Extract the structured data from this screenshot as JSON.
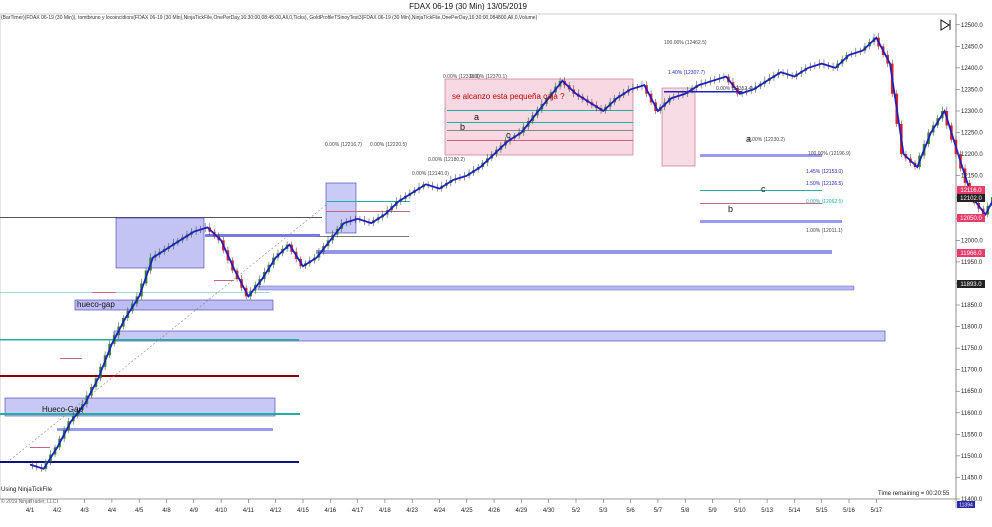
{
  "window": {
    "title": "FDAX 06-19 (30 Min)  13/05/2019",
    "indicator_line": "(BarTimer)(FDAX 06-19 (30 Min)), tomtbruno y locoincidiors(FDAX 06-19 (30 Min),NinjaTickFile,OnePerDay,16:30:00,08:45:00,All,0,Ticks), GoldProfileTSinoyTest3(FDAX 06-19 (30 Min),NinjaTickFile,OnePerDay,16:30:00,084800,All,0,Volume)",
    "time_remaining": "Time remaining = 00:20:55",
    "footer_source": "Using NinjaTickFile",
    "footer_copyright": "© 2019 NinjaTrader, LLC",
    "collapse_icon": "panel-collapse-icon"
  },
  "annotations": {
    "hueco_gap_1": "hueco-gap",
    "hueco_gap_2": "Hueco-Gap",
    "red_text": "se alcanzo esta pequeña caja ?",
    "label_a1": "a",
    "label_b1": "b",
    "label_c1": "c",
    "label_a2": "a",
    "label_b2": "b",
    "label_c2": "c"
  },
  "fib_labels": [
    "100.00% (12462.5)",
    "0.00% (12370.1)",
    "0.00% (12338.0)",
    "1.40% (12307.7)",
    "0.00% (12352.4)",
    "0.00% (12216.7)",
    "0.00% (12220.5)",
    "0.00% (12230.2)",
    "100.00% (12196.9)",
    "0.00% (12180.2)",
    "0.00% (12140.0)",
    "1.45% (12153.0)",
    "1.50% (12126.5)",
    "0.00% (12062.5)",
    "1.00% (12011.1)"
  ],
  "price_markers": [
    {
      "value": "12116.0",
      "bg": "#e83b6a"
    },
    {
      "value": "12102.0",
      "bg": "#222222"
    },
    {
      "value": "12050.0",
      "bg": "#e83b6a"
    },
    {
      "value": "11966.0",
      "bg": "#e83b6a"
    },
    {
      "value": "11893.0",
      "bg": "#222222"
    },
    {
      "value": "11394",
      "bg": "#2a2aa8"
    }
  ],
  "colors": {
    "candle_up": "#2c8a2c",
    "candle_down": "#e02020",
    "zigzag": "#2020c0",
    "box_blue": "#7a7ae6",
    "box_pink": "#f0b8cc",
    "dark_red_line": "#8b0000",
    "teal_line": "#20b0a0",
    "navy_line": "#101080",
    "text_red": "#c00000"
  },
  "chart_data": {
    "type": "candlestick",
    "title": "FDAX 06-19 (30 Min)  13/05/2019",
    "xlabel": "",
    "ylabel": "",
    "ylim": [
      11400,
      12525
    ],
    "y_ticks": [
      11400,
      11450,
      11500,
      11550,
      11600,
      11650,
      11700,
      11750,
      11800,
      11850,
      11900,
      11950,
      12000,
      12050,
      12100,
      12150,
      12200,
      12250,
      12300,
      12350,
      12400,
      12450,
      12500
    ],
    "y_tick_labels": [
      "11400.0",
      "11450.0",
      "11500.0",
      "11550.0",
      "11600.0",
      "11650.0",
      "11700.0",
      "11750.0",
      "11800.0",
      "11850.0",
      "11900.0",
      "11950.0",
      "12000.0",
      "12050.0",
      "12100.0",
      "12150.0",
      "12200.0",
      "12250.0",
      "12300.0",
      "12350.0",
      "12400.0",
      "12450.0",
      "12500.0"
    ],
    "x_ticks": [
      "4/1",
      "4/2",
      "4/3",
      "4/4",
      "4/5",
      "4/8",
      "4/9",
      "4/10",
      "4/11",
      "4/12",
      "4/15",
      "4/16",
      "4/17",
      "4/18",
      "4/23",
      "4/24",
      "4/25",
      "4/26",
      "4/29",
      "4/30",
      "5/2",
      "5/3",
      "5/6",
      "5/7",
      "5/8",
      "5/9",
      "5/10",
      "5/13",
      "5/14",
      "5/15",
      "5/16",
      "5/17"
    ],
    "grid": false,
    "legend": "none",
    "price_path": [
      [
        0,
        11480
      ],
      [
        0.5,
        11470
      ],
      [
        1,
        11520
      ],
      [
        1.5,
        11580
      ],
      [
        2,
        11620
      ],
      [
        2.5,
        11680
      ],
      [
        3,
        11760
      ],
      [
        3.5,
        11820
      ],
      [
        4,
        11870
      ],
      [
        4.5,
        11960
      ],
      [
        5,
        11980
      ],
      [
        5.5,
        12000
      ],
      [
        6,
        12020
      ],
      [
        6.5,
        12030
      ],
      [
        7,
        12000
      ],
      [
        7.5,
        11930
      ],
      [
        8,
        11870
      ],
      [
        8.5,
        11910
      ],
      [
        9,
        11960
      ],
      [
        9.5,
        11990
      ],
      [
        10,
        11940
      ],
      [
        10.5,
        11960
      ],
      [
        11,
        12000
      ],
      [
        11.5,
        12040
      ],
      [
        12,
        12050
      ],
      [
        12.5,
        12040
      ],
      [
        13,
        12060
      ],
      [
        13.5,
        12090
      ],
      [
        14,
        12110
      ],
      [
        14.5,
        12130
      ],
      [
        15,
        12120
      ],
      [
        15.5,
        12140
      ],
      [
        16,
        12150
      ],
      [
        16.5,
        12170
      ],
      [
        17,
        12200
      ],
      [
        17.5,
        12230
      ],
      [
        18,
        12250
      ],
      [
        18.5,
        12290
      ],
      [
        19,
        12330
      ],
      [
        19.5,
        12370
      ],
      [
        20,
        12340
      ],
      [
        20.5,
        12320
      ],
      [
        21,
        12300
      ],
      [
        21.5,
        12330
      ],
      [
        22,
        12350
      ],
      [
        22.5,
        12360
      ],
      [
        23,
        12300
      ],
      [
        23.5,
        12330
      ],
      [
        24,
        12340
      ],
      [
        24.5,
        12360
      ],
      [
        25,
        12370
      ],
      [
        25.5,
        12380
      ],
      [
        26,
        12340
      ],
      [
        26.5,
        12350
      ],
      [
        27,
        12370
      ],
      [
        27.5,
        12390
      ],
      [
        28,
        12380
      ],
      [
        28.5,
        12400
      ],
      [
        29,
        12410
      ],
      [
        29.5,
        12400
      ],
      [
        30,
        12430
      ],
      [
        30.5,
        12440
      ],
      [
        31,
        12470
      ],
      [
        31.5,
        12410
      ],
      [
        32,
        12200
      ],
      [
        32.5,
        12170
      ],
      [
        33,
        12250
      ],
      [
        33.5,
        12300
      ],
      [
        34,
        12200
      ],
      [
        34.5,
        12100
      ],
      [
        35,
        12060
      ],
      [
        35.5,
        12120
      ],
      [
        36,
        12160
      ],
      [
        36.5,
        12200
      ],
      [
        37,
        12150
      ],
      [
        37.5,
        12100
      ],
      [
        38,
        12050
      ],
      [
        38.5,
        11980
      ],
      [
        39,
        12050
      ],
      [
        39.5,
        12110
      ],
      [
        40,
        12130
      ],
      [
        40.5,
        12100
      ],
      [
        41,
        12050
      ],
      [
        41.5,
        12000
      ],
      [
        42,
        11960
      ],
      [
        42.5,
        11900
      ],
      [
        42.8,
        11893
      ]
    ]
  }
}
